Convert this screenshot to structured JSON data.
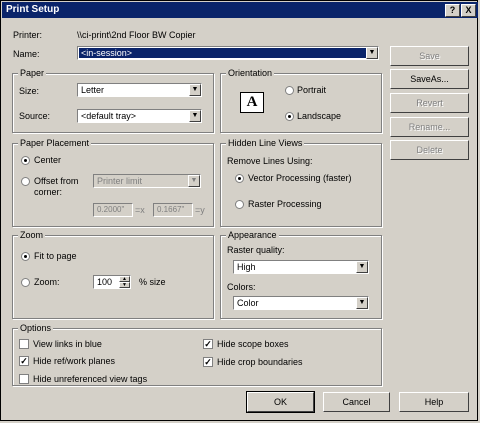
{
  "window": {
    "title": "Print Setup",
    "help_btn": "?",
    "close_btn": "X"
  },
  "printer": {
    "label": "Printer:",
    "value": "\\\\ci-print\\2nd Floor BW Copier"
  },
  "name": {
    "label": "Name:",
    "value": "<in-session>"
  },
  "side_buttons": {
    "save": "Save",
    "saveas": "SaveAs...",
    "revert": "Revert",
    "rename": "Rename...",
    "delete": "Delete"
  },
  "paper": {
    "group": "Paper",
    "size_label": "Size:",
    "size_value": "Letter",
    "source_label": "Source:",
    "source_value": "<default tray>"
  },
  "orientation": {
    "group": "Orientation",
    "icon_text": "A",
    "portrait": "Portrait",
    "landscape": "Landscape"
  },
  "placement": {
    "group": "Paper Placement",
    "center": "Center",
    "offset": "Offset from",
    "corner": "corner:",
    "limit": "Printer limit",
    "x_value": "0.2000\"",
    "x_unit": "=x",
    "y_value": "0.1667\"",
    "y_unit": "=y"
  },
  "hidden": {
    "group": "Hidden Line Views",
    "remove_label": "Remove Lines Using:",
    "vector": "Vector Processing (faster)",
    "raster": "Raster Processing"
  },
  "zoom": {
    "group": "Zoom",
    "fit": "Fit to page",
    "zoom_label": "Zoom:",
    "zoom_value": "100",
    "size_unit": "% size"
  },
  "appearance": {
    "group": "Appearance",
    "raster_label": "Raster quality:",
    "raster_value": "High",
    "colors_label": "Colors:",
    "colors_value": "Color"
  },
  "options": {
    "group": "Options",
    "links_blue": "View links in blue",
    "hide_ref": "Hide ref/work planes",
    "hide_unref": "Hide unreferenced view tags",
    "hide_scope": "Hide scope boxes",
    "hide_crop": "Hide crop boundaries"
  },
  "footer": {
    "ok": "OK",
    "cancel": "Cancel",
    "help": "Help"
  }
}
